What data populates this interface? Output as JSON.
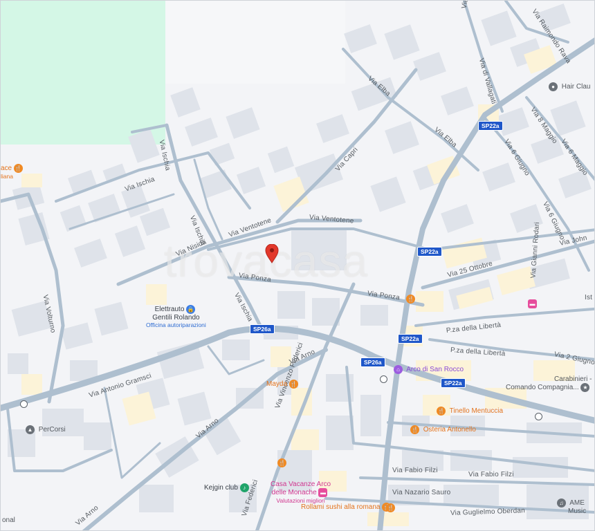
{
  "colors": {
    "road": "#aebfcf",
    "block": "#dfe3ea",
    "park": "#d4f7e6",
    "highway_shield": "#1f57c9",
    "pin": "#e2382b"
  },
  "watermark": "trovacasa",
  "streets": {
    "via_ischia_1": "Via Ischia",
    "via_ischia_2": "Via Ischia",
    "via_ischia_3": "Via Ischia",
    "via_ischia_4": "Via Ischia",
    "via_nisida": "Via Nisida",
    "via_ventotene_1": "Via Ventotene",
    "via_ventotene_2": "Via Ventotene",
    "via_ponza_1": "Via Ponza",
    "via_ponza_2": "Via Ponza",
    "via_capri": "Via Capri",
    "via_elba_1": "Via Elba",
    "via_elba_2": "Via Elba",
    "via_di_vallagati_1": "Via di Vallagati",
    "via_di_vallagati_2": "Via di Vallagati",
    "via_raimondo": "Via Raimondo Rava",
    "via_6_giugno_1": "Via 6 Giugno",
    "via_6_giugno_2": "Via 6 Giugno",
    "via_8_maggio": "Via 8 Maggio",
    "via_6_maggio": "Via 6 Maggio",
    "via_john": "Via John",
    "via_25_ottobre": "Via 25 Ottobre",
    "via_gianni_rodari": "Via Gianni Rodari",
    "pza_liberta_1": "P.za della Libertà",
    "pza_liberta_2": "P.za della Libertà",
    "via_2_giugno": "Via 2 Giugno",
    "via_volturno": "Via Volturno",
    "via_antonio_gramsci": "Via Antonio Gramsci",
    "via_arno_1": "Via Arno",
    "via_arno_2": "Via Arno",
    "via_arno_3": "Via Arno",
    "via_vincenzo_federici": "Via Vincenzo Federici",
    "via_federici": "Via Federici",
    "via_fabio_filzi_1": "Via Fabio Filzi",
    "via_fabio_filzi_2": "Via Fabio Filzi",
    "via_nazario_sauro": "Via Nazario Sauro",
    "via_guglielmo_oberdan": "Via Guglielmo Oberdan",
    "ist": "Ist"
  },
  "shields": {
    "sp22a_1": "SP22a",
    "sp22a_2": "SP22a",
    "sp22a_3": "SP22a",
    "sp22a_4": "SP22a",
    "sp26a_1": "SP26a",
    "sp26a_2": "SP26a"
  },
  "pois": {
    "ace": {
      "name": "ace",
      "sub": "liana",
      "icon": "restaurant-icon"
    },
    "elettrauto": {
      "name": "Elettrauto",
      "name2": "Gentili Rolando",
      "sub": "Officina autoriparazioni",
      "icon": "lock-icon"
    },
    "hair": {
      "name": "Hair Clau",
      "icon": "place-icon"
    },
    "mayda": {
      "name": "Mayda",
      "icon": "restaurant-icon"
    },
    "arco": {
      "name": "Arco di San Rocco",
      "icon": "monument-icon"
    },
    "carabinieri": {
      "name": "Carabinieri -",
      "name2": "Comando Compagnia...",
      "icon": "police-icon"
    },
    "tinello": {
      "name": "Tinello Mentuccia",
      "icon": "restaurant-icon"
    },
    "osteria": {
      "name": "Osteria Antonello",
      "icon": "restaurant-icon"
    },
    "percorsi": {
      "name": "PerCorsi",
      "icon": "school-icon"
    },
    "kejgin": {
      "name": "Kejgin club",
      "icon": "club-icon"
    },
    "casa": {
      "name": "Casa Vacanze Arco",
      "name2": "delle Monache",
      "sub": "Valutazioni migliori",
      "icon": "hotel-icon"
    },
    "rollami": {
      "name": "Rollami sushi alla romana",
      "icon": "restaurant-icon"
    },
    "ame": {
      "name": "AME",
      "name2": "Music",
      "icon": "music-icon"
    },
    "onal": {
      "name": "onal"
    }
  }
}
